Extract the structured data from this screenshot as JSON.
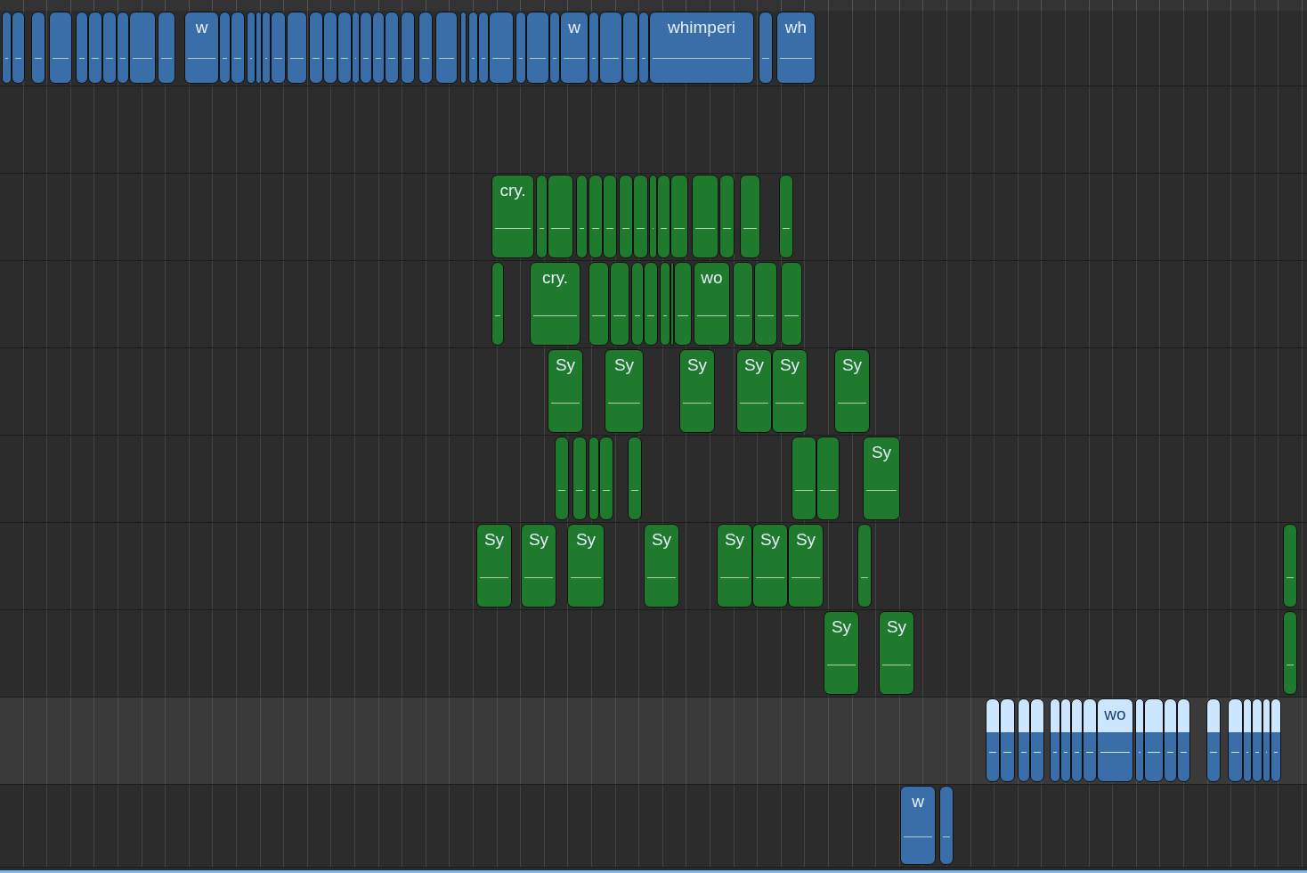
{
  "tracks": [
    {
      "color": "#3a6ea8",
      "selected": false,
      "regions": [
        {
          "selected": false
        },
        {
          "selected": false
        },
        {
          "selected": false
        },
        {
          "selected": false
        },
        {
          "selected": false
        },
        {
          "selected": false
        },
        {
          "selected": false
        },
        {
          "selected": false
        },
        {
          "selected": false
        },
        {
          "selected": false
        },
        {
          "label": "w",
          "selected": false
        },
        {
          "selected": false
        },
        {
          "selected": false
        },
        {
          "selected": false
        },
        {
          "selected": false
        },
        {
          "selected": false
        },
        {
          "selected": false
        },
        {
          "selected": false
        },
        {
          "selected": false
        },
        {
          "selected": false
        },
        {
          "selected": false
        },
        {
          "selected": false
        },
        {
          "selected": false
        },
        {
          "selected": false
        },
        {
          "selected": false
        },
        {
          "selected": false
        },
        {
          "selected": false
        },
        {
          "selected": false
        },
        {
          "selected": false
        },
        {
          "selected": false
        },
        {
          "selected": false
        },
        {
          "selected": false
        },
        {
          "selected": false
        },
        {
          "selected": false
        },
        {
          "selected": false
        },
        {
          "label": "w",
          "selected": false
        },
        {
          "selected": false
        },
        {
          "selected": false
        },
        {
          "selected": false
        },
        {
          "selected": false
        },
        {
          "label": "whimperi",
          "selected": false
        },
        {
          "selected": false
        },
        {
          "label": "wh",
          "selected": false
        }
      ]
    },
    {
      "selected": false
    },
    {
      "color": "#1f7a2e",
      "selected": false,
      "regions": [
        {
          "label": "cry.",
          "selected": false
        },
        {
          "selected": false
        },
        {
          "selected": false
        },
        {
          "selected": false
        },
        {
          "selected": false
        },
        {
          "selected": false
        },
        {
          "selected": false
        },
        {
          "selected": false
        },
        {
          "selected": false
        },
        {
          "selected": false
        },
        {
          "selected": false
        },
        {
          "selected": false
        },
        {
          "selected": false
        },
        {
          "selected": false
        },
        {
          "selected": false
        }
      ]
    },
    {
      "color": "#1f7a2e",
      "selected": false,
      "regions": [
        {
          "selected": false
        },
        {
          "label": "cry.",
          "selected": false
        },
        {
          "selected": false
        },
        {
          "selected": false
        },
        {
          "selected": false
        },
        {
          "selected": false
        },
        {
          "selected": false
        },
        {
          "selected": false
        },
        {
          "selected": false
        },
        {
          "label": "wo",
          "selected": false
        },
        {
          "selected": false
        },
        {
          "selected": false
        },
        {
          "selected": false
        }
      ]
    },
    {
      "color": "#1f7a2e",
      "selected": false,
      "regions": [
        {
          "label": "Sy",
          "selected": false
        },
        {
          "label": "Sy",
          "selected": false
        },
        {
          "label": "Sy",
          "selected": false
        },
        {
          "label": "Sy",
          "selected": false
        },
        {
          "label": "Sy",
          "selected": false
        },
        {
          "label": "Sy",
          "selected": false
        }
      ]
    },
    {
      "color": "#1f7a2e",
      "selected": false,
      "regions": [
        {
          "selected": false
        },
        {
          "selected": false
        },
        {
          "selected": false
        },
        {
          "selected": false
        },
        {
          "selected": false
        },
        {
          "selected": false
        },
        {
          "selected": false
        },
        {
          "label": "Sy",
          "selected": false
        }
      ]
    },
    {
      "color": "#1f7a2e",
      "selected": false,
      "regions": [
        {
          "label": "Sy",
          "selected": false
        },
        {
          "label": "Sy",
          "selected": false
        },
        {
          "label": "Sy",
          "selected": false
        },
        {
          "label": "Sy",
          "selected": false
        },
        {
          "label": "Sy",
          "selected": false
        },
        {
          "label": "Sy",
          "selected": false
        },
        {
          "label": "Sy",
          "selected": false
        },
        {
          "selected": false
        },
        {
          "selected": false
        }
      ]
    },
    {
      "color": "#1f7a2e",
      "selected": false,
      "regions": [
        {
          "label": "Sy",
          "selected": false
        },
        {
          "label": "Sy",
          "selected": false
        },
        {
          "selected": false
        }
      ]
    },
    {
      "color": "#3a6ea8",
      "selected": true,
      "regions": [
        {
          "selected": true
        },
        {
          "selected": true
        },
        {
          "selected": true
        },
        {
          "selected": true
        },
        {
          "selected": true
        },
        {
          "selected": true
        },
        {
          "selected": true
        },
        {
          "selected": true
        },
        {
          "label": "wo",
          "selected": true
        },
        {
          "selected": true
        },
        {
          "selected": true
        },
        {
          "selected": true
        },
        {
          "selected": true
        },
        {
          "selected": true
        },
        {
          "selected": true
        },
        {
          "selected": true
        },
        {
          "selected": true
        },
        {
          "selected": true
        },
        {
          "selected": true
        }
      ]
    },
    {
      "color": "#3a6ea8",
      "selected": false,
      "regions": [
        {
          "label": "w",
          "selected": false
        },
        {
          "selected": false
        }
      ]
    }
  ]
}
